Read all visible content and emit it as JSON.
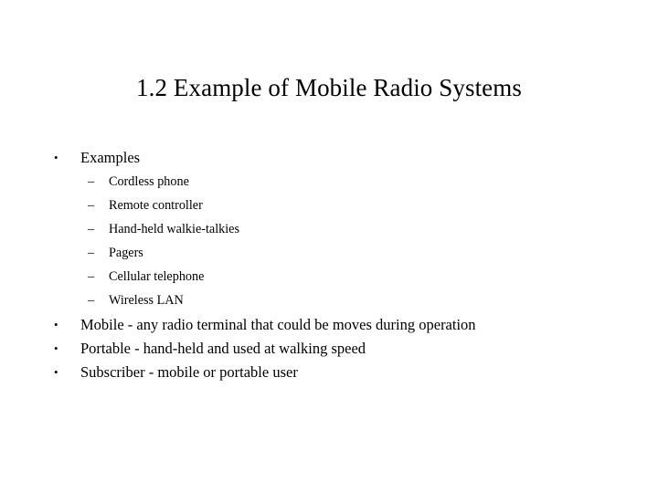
{
  "slide": {
    "title": "1.2 Example of Mobile Radio Systems",
    "background_color": "#ffffff",
    "text_color": "#000000",
    "markers": {
      "level1": "•",
      "level2": "–"
    },
    "content": [
      {
        "level": 1,
        "marker": "•",
        "text": "Examples"
      },
      {
        "level": 2,
        "marker": "–",
        "text": "Cordless phone"
      },
      {
        "level": 2,
        "marker": "–",
        "text": "Remote controller"
      },
      {
        "level": 2,
        "marker": "–",
        "text": "Hand-held walkie-talkies"
      },
      {
        "level": 2,
        "marker": "–",
        "text": "Pagers"
      },
      {
        "level": 2,
        "marker": "–",
        "text": "Cellular telephone"
      },
      {
        "level": 2,
        "marker": "–",
        "text": "Wireless LAN"
      },
      {
        "level": 1,
        "marker": "•",
        "text": "Mobile - any radio terminal that could be moves during operation"
      },
      {
        "level": 1,
        "marker": "•",
        "text": "Portable - hand-held and used at walking speed"
      },
      {
        "level": 1,
        "marker": "•",
        "text": "Subscriber - mobile or portable user"
      }
    ]
  }
}
